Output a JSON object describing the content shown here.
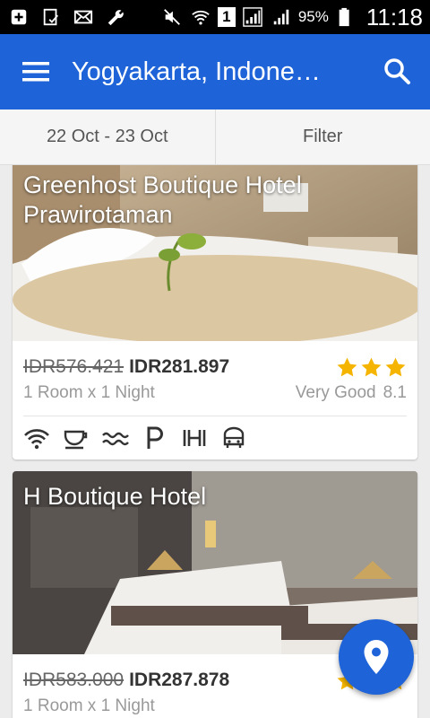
{
  "status_bar": {
    "battery_percent": "95%",
    "time": "11:18",
    "sim_slot": "1",
    "icons": [
      "add-box-icon",
      "clipboard-check-icon",
      "mail-icon",
      "wrench-icon",
      "muted-icon",
      "wifi-icon",
      "sim-1-icon",
      "signal-icon",
      "signal-icon",
      "battery-icon"
    ]
  },
  "app_bar": {
    "menu_icon": "hamburger-menu-icon",
    "title": "Yogyakarta, Indone…",
    "search_icon": "search-icon"
  },
  "filter_bar": {
    "dates": "22 Oct - 23 Oct",
    "filter": "Filter"
  },
  "hotels": [
    {
      "name_line1": "Greenhost Boutique Hotel",
      "name_line2": "Prawirotaman",
      "old_price": "IDR576.421",
      "new_price": "IDR281.897",
      "stars": 3,
      "stay": "1 Room x 1 Night",
      "rating_label": "Very Good",
      "rating_score": "8.1",
      "amenities": [
        "wifi-icon",
        "breakfast-icon",
        "pool-icon",
        "parking-icon",
        "gym-icon",
        "shuttle-icon"
      ]
    },
    {
      "name_line1": "H Boutique Hotel",
      "old_price": "IDR583.000",
      "new_price": "IDR287.878",
      "stars": 3,
      "stay": "1 Room x 1 Night"
    }
  ],
  "fab": {
    "icon": "map-pin-icon"
  },
  "colors": {
    "primary": "#1e63d8",
    "star": "#f4b400",
    "background": "#ececec"
  }
}
